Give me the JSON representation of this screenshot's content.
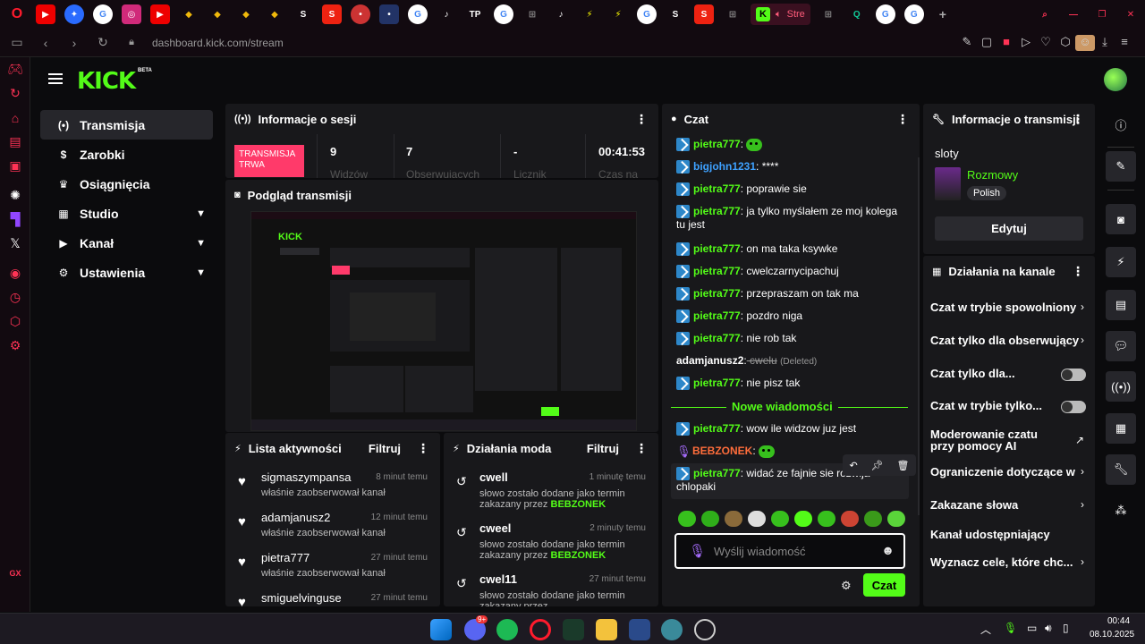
{
  "browser": {
    "tab_title": "Stre",
    "url": "dashboard.kick.com/stream"
  },
  "app": {
    "logo": "KICK",
    "logo_badge": "BETA"
  },
  "nav": [
    {
      "label": "Transmisja",
      "icon": "broadcast-icon",
      "active": true
    },
    {
      "label": "Zarobki",
      "icon": "money-icon"
    },
    {
      "label": "Osiągnięcia",
      "icon": "trophy-icon"
    },
    {
      "label": "Studio",
      "icon": "studio-icon",
      "expandable": true
    },
    {
      "label": "Kanał",
      "icon": "channel-icon",
      "expandable": true
    },
    {
      "label": "Ustawienia",
      "icon": "gear-icon",
      "expandable": true
    }
  ],
  "session": {
    "title": "Informacje o sesji",
    "live_label": "TRANSMISJA TRWA",
    "viewers": "9",
    "viewers_label": "Widzów",
    "followers": "7",
    "followers_label": "Obserwujących",
    "counter": "-",
    "counter_label": "Licznik",
    "time": "00:41:53",
    "time_label": "Czas na"
  },
  "preview": {
    "title": "Podgląd transmisji"
  },
  "activity": {
    "title": "Lista aktywności",
    "filter": "Filtruj",
    "items": [
      {
        "name": "sigmaszympansa",
        "time": "8 minut temu",
        "desc": "właśnie zaobserwował kanał"
      },
      {
        "name": "adamjanusz2",
        "time": "12 minut temu",
        "desc": "właśnie zaobserwował kanał"
      },
      {
        "name": "pietra777",
        "time": "27 minut temu",
        "desc": "właśnie zaobserwował kanał"
      },
      {
        "name": "smiguelvinguse",
        "time": "27 minut temu",
        "desc": ""
      }
    ]
  },
  "mod": {
    "title": "Działania moda",
    "filter": "Filtruj",
    "items": [
      {
        "name": "cwell",
        "time": "1 minutę temu",
        "desc": "słowo zostało dodane jako termin zakazany przez",
        "by": "BEBZONEK"
      },
      {
        "name": "cweel",
        "time": "2 minuty temu",
        "desc": "słowo zostało dodane jako termin zakazany przez",
        "by": "BEBZONEK"
      },
      {
        "name": "cwel11",
        "time": "27 minut temu",
        "desc": "słowo zostało dodane jako termin zakazany przez",
        "by": ""
      }
    ]
  },
  "chat": {
    "title": "Czat",
    "new_messages": "Nowe wiadomości",
    "placeholder": "Wyślij wiadomość",
    "send": "Czat",
    "messages": [
      {
        "user": "pietra777",
        "text": ""
      },
      {
        "user": "bigjohn1231",
        "text": " ****"
      },
      {
        "user": "pietra777",
        "text": " poprawie sie"
      },
      {
        "user": "pietra777",
        "text": " ja tylko myślałem ze moj kolega tu jest"
      },
      {
        "user": "pietra777",
        "text": " on ma taka ksywke"
      },
      {
        "user": "pietra777",
        "text": " cwelczarnycipachuj"
      },
      {
        "user": "pietra777",
        "text": " przepraszam on tak ma"
      },
      {
        "user": "pietra777",
        "text": " pozdro niga"
      },
      {
        "user": "pietra777",
        "text": " nie rob tak"
      },
      {
        "user": "adamjanusz2",
        "text": " cwelu",
        "note": "(Deleted)"
      },
      {
        "user": "pietra777",
        "text": " nie pisz tak"
      },
      {
        "user": "pietra777",
        "text": " wow ile widzow juz jest"
      },
      {
        "user": "BEBZONEK",
        "text": ""
      },
      {
        "user": "pietra777",
        "text": " widać ze fajnie sie rozwija chlopaki"
      }
    ]
  },
  "stream_info": {
    "title": "Informacje o transmisji",
    "stream_title": "sloty",
    "category": "Rozmowy",
    "language": "Polish",
    "edit": "Edytuj"
  },
  "channel_actions": {
    "title": "Działania na kanale",
    "items": [
      {
        "label": "Czat w trybie spowolniony",
        "kind": "arrow"
      },
      {
        "label": "Czat tylko dla obserwujący",
        "kind": "arrow"
      },
      {
        "label": "Czat tylko dla...",
        "kind": "toggle"
      },
      {
        "label": "Czat w trybie tylko...",
        "kind": "toggle"
      },
      {
        "label": "Moderowanie czatu przy pomocy AI",
        "kind": "external"
      },
      {
        "label": "Ograniczenie dotyczące w",
        "kind": "arrow"
      },
      {
        "label": "Zakazane słowa",
        "kind": "arrow"
      },
      {
        "label": "Kanał udostępniający",
        "kind": "none"
      },
      {
        "label": "Wyznacz cele, które chc...",
        "kind": "arrow"
      }
    ]
  },
  "taskbar": {
    "time": "00:44",
    "date": "08.10.2025",
    "discord_badge": "9+"
  },
  "colors": {
    "accent": "#53fc18",
    "live": "#ff3a6a",
    "panel": "#18181b"
  }
}
